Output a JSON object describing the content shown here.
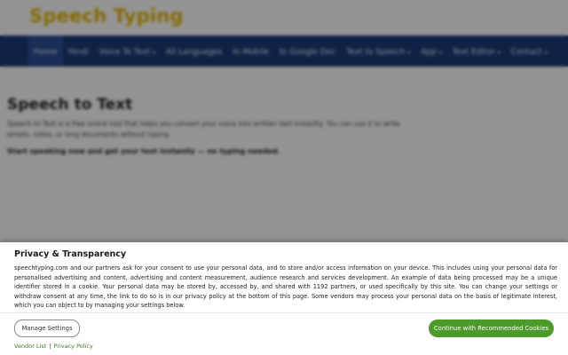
{
  "site": {
    "logo": "Speech Typing"
  },
  "nav": {
    "items": [
      {
        "label": "Home",
        "dropdown": false
      },
      {
        "label": "Hindi",
        "dropdown": false
      },
      {
        "label": "Voice To Text",
        "dropdown": true
      },
      {
        "label": "All Languages",
        "dropdown": false
      },
      {
        "label": "In Mobile",
        "dropdown": false
      },
      {
        "label": "In Google Doc",
        "dropdown": false
      },
      {
        "label": "Text to Speech",
        "dropdown": true
      },
      {
        "label": "App",
        "dropdown": true
      },
      {
        "label": "Text Editor",
        "dropdown": true
      },
      {
        "label": "Contact",
        "dropdown": true
      }
    ],
    "caret": "▾"
  },
  "content": {
    "heading": "Speech to Text",
    "intro": "Speech to Text is a free online tool that helps you convert your voice into written text instantly. You can use it to write emails, notes, or long documents without typing.",
    "cta": "Start speaking now and get your text instantly — no typing needed."
  },
  "consent": {
    "title": "Privacy & Transparency",
    "body": "speechtyping.com and our partners ask for your consent to use your personal data, and to store and/or access information on your device. This includes using your personal data for personalised advertising and content, advertising and content measurement, audience research and services development. An example of data being processed may be a unique identifier stored in a cookie. Your personal data may be stored by, accessed by, and shared with 1192 partners, or used specifically by this site. You can change your settings or withdraw consent at any time, the link to do so is in our privacy policy at the bottom of this page. Some vendors may process your personal data on the basis of legitimate interest, which you can object to by managing your settings below.",
    "manage_label": "Manage Settings",
    "accept_label": "Continue with Recommended Cookies",
    "vendor_link": "Vendor List",
    "link_separator": "|",
    "privacy_link": "Privacy Policy"
  },
  "colors": {
    "nav_bg": "#1b3c78",
    "logo": "#e6b800",
    "accept_bg": "#4c9a2a",
    "link": "#3a7d1e"
  }
}
